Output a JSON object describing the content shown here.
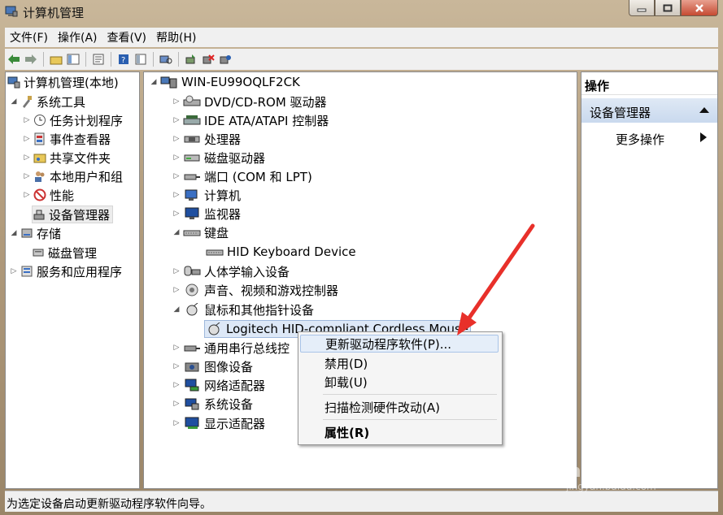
{
  "window": {
    "title": "计算机管理"
  },
  "menu": [
    "文件(F)",
    "操作(A)",
    "查看(V)",
    "帮助(H)"
  ],
  "left_tree": [
    {
      "label": "计算机管理(本地)",
      "icon": "computer-manage-icon"
    },
    {
      "label": "系统工具",
      "icon": "tools-icon"
    },
    {
      "label": "任务计划程序",
      "icon": "clock-icon"
    },
    {
      "label": "事件查看器",
      "icon": "event-viewer-icon"
    },
    {
      "label": "共享文件夹",
      "icon": "shared-folder-icon"
    },
    {
      "label": "本地用户和组",
      "icon": "users-icon"
    },
    {
      "label": "性能",
      "icon": "performance-icon"
    },
    {
      "label": "设备管理器",
      "icon": "device-manager-icon"
    },
    {
      "label": "存储",
      "icon": "storage-icon"
    },
    {
      "label": "磁盘管理",
      "icon": "disk-icon"
    },
    {
      "label": "服务和应用程序",
      "icon": "services-icon"
    }
  ],
  "device_tree": {
    "root": "WIN-EU99OQLF2CK",
    "items": [
      "DVD/CD-ROM 驱动器",
      "IDE ATA/ATAPI 控制器",
      "处理器",
      "磁盘驱动器",
      "端口 (COM 和 LPT)",
      "计算机",
      "监视器",
      "键盘",
      "HID Keyboard Device",
      "人体学输入设备",
      "声音、视频和游戏控制器",
      "鼠标和其他指针设备",
      "Logitech HID-compliant Cordless Mouse",
      "通用串行总线控",
      "图像设备",
      "网络适配器",
      "系统设备",
      "显示适配器"
    ]
  },
  "actions": {
    "header": "操作",
    "section": "设备管理器",
    "more": "更多操作"
  },
  "context_menu": {
    "update": "更新驱动程序软件(P)...",
    "disable": "禁用(D)",
    "uninstall": "卸载(U)",
    "scan": "扫描检测硬件改动(A)",
    "properties": "属性(R)"
  },
  "status": "为选定设备启动更新驱动程序软件向导。",
  "watermark": {
    "brand": "Bai du 经验",
    "url": "jingyan.baidu.com"
  },
  "colors": {
    "arrow": "#e8302a",
    "selection": "#dde8f7",
    "action_section": "#c9d9ee"
  }
}
